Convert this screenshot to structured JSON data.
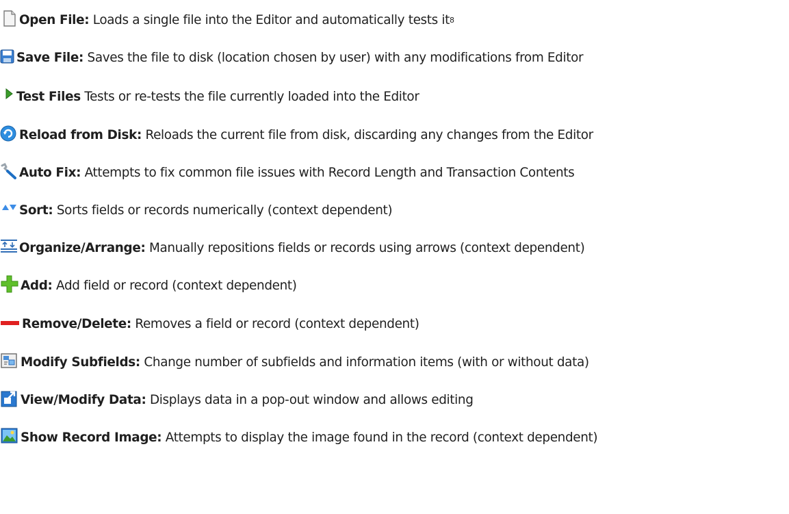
{
  "items": [
    {
      "icon": "open-file-icon",
      "term": "Open File:",
      "desc": "Loads a single file into the Editor and automatically tests it",
      "footnote": "8"
    },
    {
      "icon": "save-file-icon",
      "term": "Save File:",
      "desc": "Saves the file to disk (location chosen by user) with any modifications from Editor"
    },
    {
      "icon": "test-play-icon",
      "term": "Test Files",
      "desc": "Tests or re-tests the file currently loaded into the Editor"
    },
    {
      "icon": "reload-icon",
      "term": "Reload from Disk:",
      "desc": "Reloads the current file from disk, discarding any changes from the Editor"
    },
    {
      "icon": "wrench-icon",
      "term": "Auto Fix:",
      "desc": "Attempts to fix common file issues with Record Length and Transaction Contents"
    },
    {
      "icon": "sort-icon",
      "term": "Sort:",
      "desc": "Sorts fields or records numerically (context dependent)"
    },
    {
      "icon": "organize-arrange-icon",
      "term": "Organize/Arrange:",
      "desc": "Manually repositions fields or records using arrows (context dependent)"
    },
    {
      "icon": "add-plus-icon",
      "term": "Add:",
      "desc": "Add field or record (context dependent)"
    },
    {
      "icon": "remove-minus-icon",
      "term": "Remove/Delete:",
      "desc": "Removes a field or record (context dependent)"
    },
    {
      "icon": "modify-subfields-icon",
      "term": "Modify Subfields:",
      "desc": "Change number of subfields and information items (with or without data)"
    },
    {
      "icon": "view-modify-data-icon",
      "term": "View/Modify Data:",
      "desc": "Displays data in a pop-out window and allows editing"
    },
    {
      "icon": "show-image-icon",
      "term": "Show Record Image:",
      "desc": "Attempts to display the image found in the record (context dependent)"
    }
  ]
}
